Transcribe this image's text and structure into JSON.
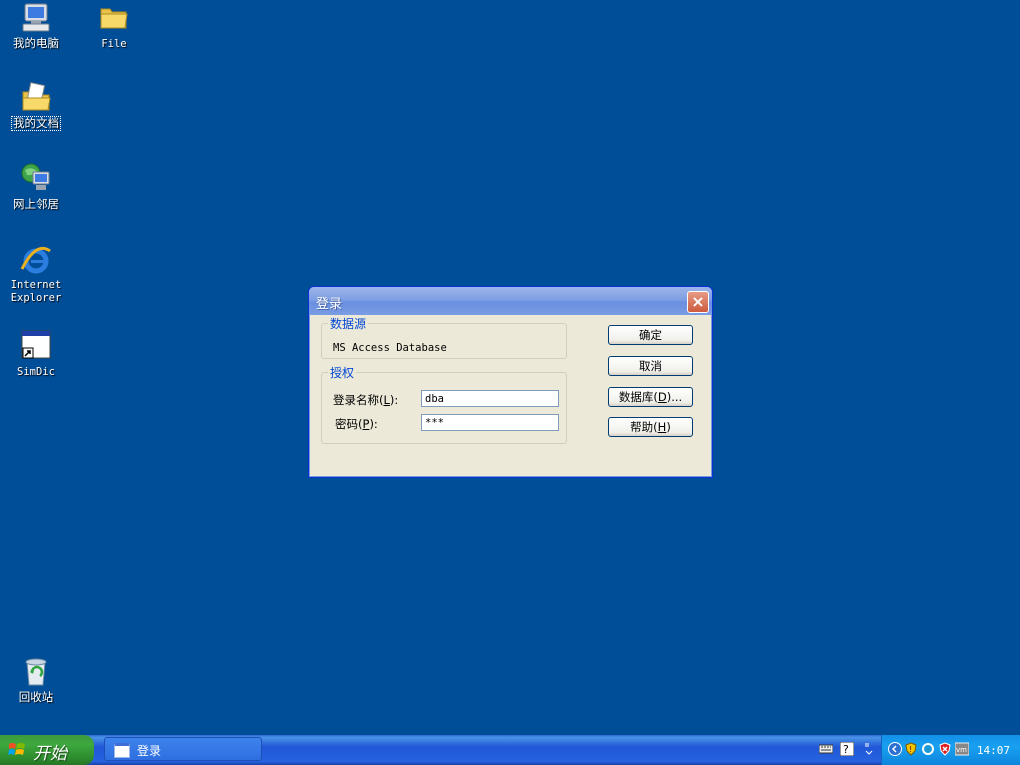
{
  "desktop": {
    "icons": [
      {
        "label": "我的电脑",
        "icon": "my-computer-icon"
      },
      {
        "label": "File",
        "icon": "folder-icon"
      },
      {
        "label": "我的文档",
        "icon": "my-documents-icon"
      },
      {
        "label": "网上邻居",
        "icon": "network-places-icon"
      },
      {
        "label": "Internet Explorer",
        "icon": "internet-explorer-icon"
      },
      {
        "label": "SimDic",
        "icon": "simdic-shortcut-icon"
      },
      {
        "label": "回收站",
        "icon": "recycle-bin-icon"
      }
    ]
  },
  "dialog": {
    "title": "登录",
    "datasource": {
      "legend": "数据源",
      "value": "MS Access Database"
    },
    "auth": {
      "legend": "授权",
      "login_label": "登录名称",
      "login_mnemonic": "L",
      "login_value": "dba",
      "password_label": "密码",
      "password_mnemonic": "P",
      "password_value": "***"
    },
    "buttons": {
      "ok": "确定",
      "cancel": "取消",
      "database_label": "数据库",
      "database_mnemonic": "D",
      "database_suffix": "...",
      "help_label": "帮助",
      "help_mnemonic": "H"
    }
  },
  "taskbar": {
    "start_label": "开始",
    "task_items": [
      {
        "label": "登录"
      }
    ],
    "clock": "14:07"
  },
  "colors": {
    "desktop_bg": "#004e98",
    "taskbar": "#2457d4",
    "start_green": "#3ea93e",
    "legend_blue": "#0046d5"
  }
}
